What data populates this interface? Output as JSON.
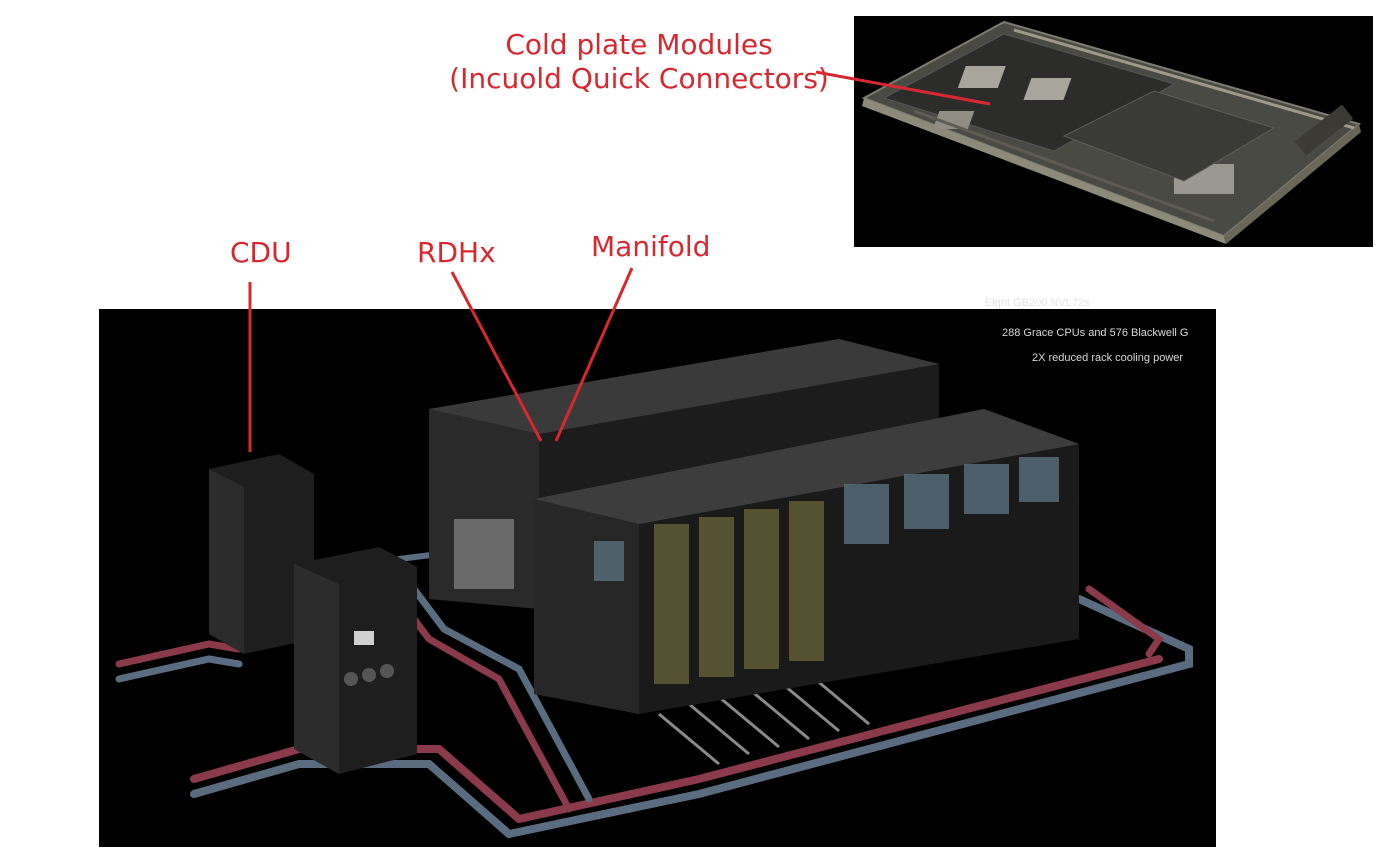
{
  "labels": {
    "cold_plate_line1": "Cold plate Modules",
    "cold_plate_line2": "(Incuold Quick Connectors)",
    "cdu": "CDU",
    "rdhx": "RDHx",
    "manifold": "Manifold"
  },
  "overlay": {
    "line1": "Eight GB200 NVL72s",
    "line2": "288 Grace CPUs and 576 Blackwell G",
    "line3": "2X reduced rack cooling power"
  },
  "colors": {
    "annotation": "#d7282f",
    "scene_background": "#000000",
    "pipe_red": "#8a3a4a",
    "pipe_blue": "#5a6d80"
  }
}
